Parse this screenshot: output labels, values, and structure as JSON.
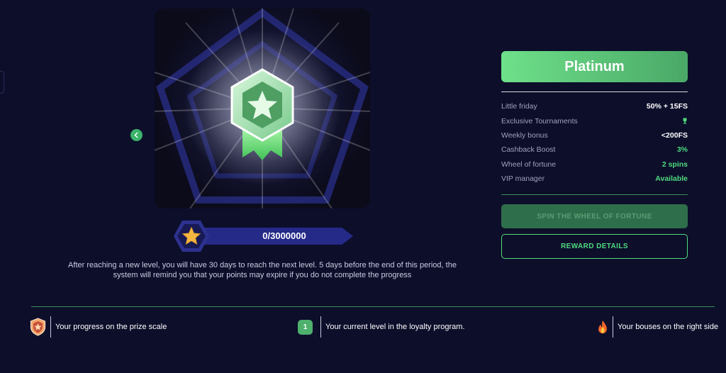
{
  "progress": {
    "value_text": "0/3000000"
  },
  "description": "After reaching a new level, you will have 30 days to reach the next level. 5 days before the end of this period, the system will remind you that your points may expire if you do not complete the progress",
  "level": {
    "name": "Platinum"
  },
  "benefits": [
    {
      "label": "Little friday",
      "value": "50% + 15FS"
    },
    {
      "label": "Exclusive Tournaments",
      "value": "",
      "icon": "trophy-icon"
    },
    {
      "label": "Weekly bonus",
      "value": "<200FS"
    },
    {
      "label": "Cashback Boost",
      "value": "3%"
    },
    {
      "label": "Wheel of fortune",
      "value": "2 spins"
    },
    {
      "label": "VIP manager",
      "value": "Available"
    }
  ],
  "buttons": {
    "spin": "SPIN THE WHEEL OF FORTUNE",
    "reward": "REWARD DETAILS"
  },
  "legend": [
    {
      "text": "Your progress on the prize scale",
      "icon": "shield-badge-icon"
    },
    {
      "text": "Your current level in the loyalty program.",
      "badge": "1"
    },
    {
      "text": "Your bouses on the right side",
      "icon": "fire-icon"
    }
  ],
  "colors": {
    "accent": "#4ddb7f",
    "background": "#0d0e2a",
    "progress_bar": "#252a88"
  }
}
